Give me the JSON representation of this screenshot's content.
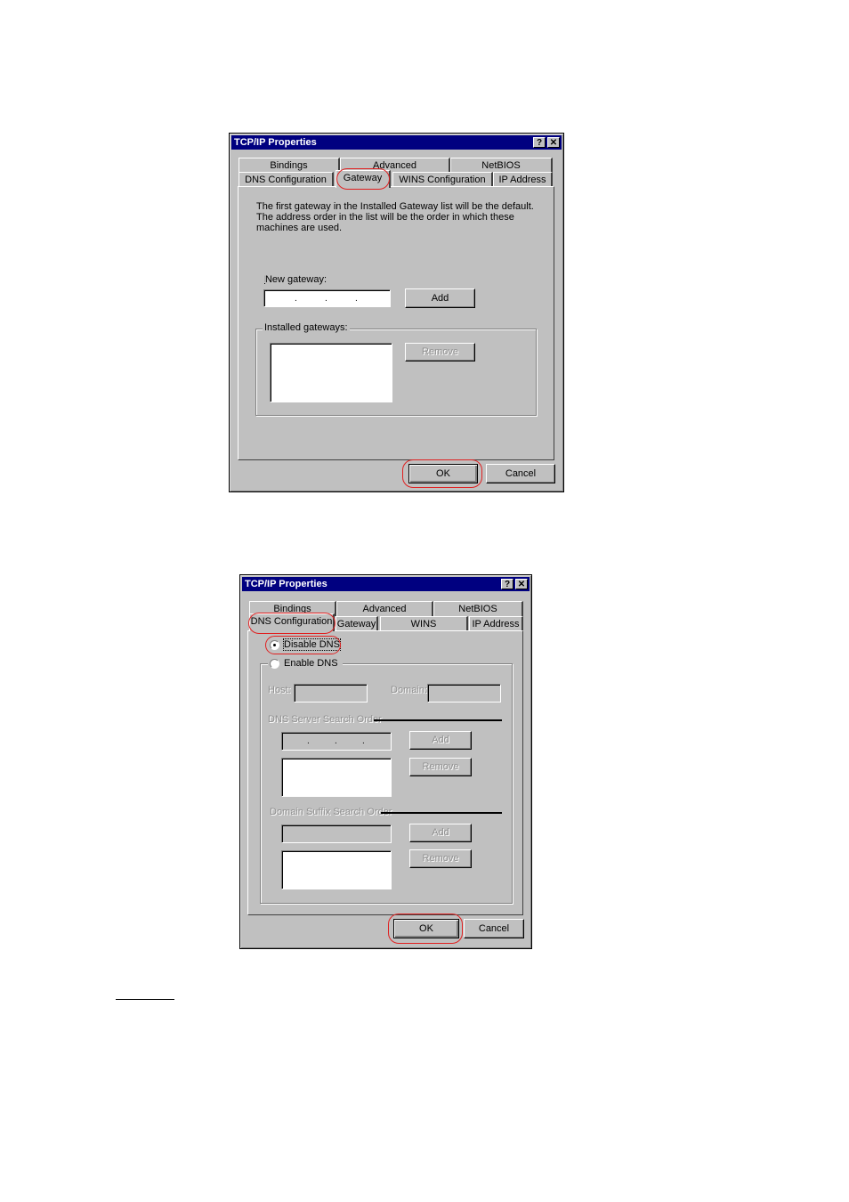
{
  "dialog1": {
    "title": "TCP/IP Properties",
    "help_btn": "?",
    "close_btn": "✕",
    "tabs_row1": [
      "Bindings",
      "Advanced",
      "NetBIOS"
    ],
    "tabs_row2": [
      "DNS Configuration",
      "Gateway",
      "WINS Configuration",
      "IP Address"
    ],
    "active_tab": "Gateway",
    "description": "The first gateway in the Installed Gateway list will be the default. The address order in the list will be the order in which these machines are used.",
    "new_gateway_label": "New gateway:",
    "new_gateway_value": ".   .   .",
    "add_button": "Add",
    "installed_label": "Installed gateways:",
    "remove_button": "Remove",
    "ok_button": "OK",
    "cancel_button": "Cancel",
    "highlights": [
      "Gateway tab",
      "OK button"
    ],
    "highlight_color": "#e02020"
  },
  "dialog2": {
    "title": "TCP/IP Properties",
    "help_btn": "?",
    "close_btn": "✕",
    "tabs_row1": [
      "Bindings",
      "Advanced",
      "NetBIOS"
    ],
    "tabs_row2": [
      "DNS Configuration",
      "Gateway",
      "WINS Configuration",
      "IP Address"
    ],
    "active_tab": "DNS Configuration",
    "disable_dns": "Disable DNS",
    "enable_dns": "Enable DNS",
    "selected_option": "Disable DNS",
    "host_label": "Host:",
    "domain_label": "Domain:",
    "dns_server_order_label": "DNS Server Search Order",
    "add_button": "Add",
    "remove_button": "Remove",
    "domain_suffix_label": "Domain Suffix Search Order",
    "add_button2": "Add",
    "remove_button2": "Remove",
    "ok_button": "OK",
    "cancel_button": "Cancel",
    "highlights": [
      "DNS Configuration tab",
      "Disable DNS option",
      "OK button"
    ],
    "highlight_color": "#e02020"
  }
}
